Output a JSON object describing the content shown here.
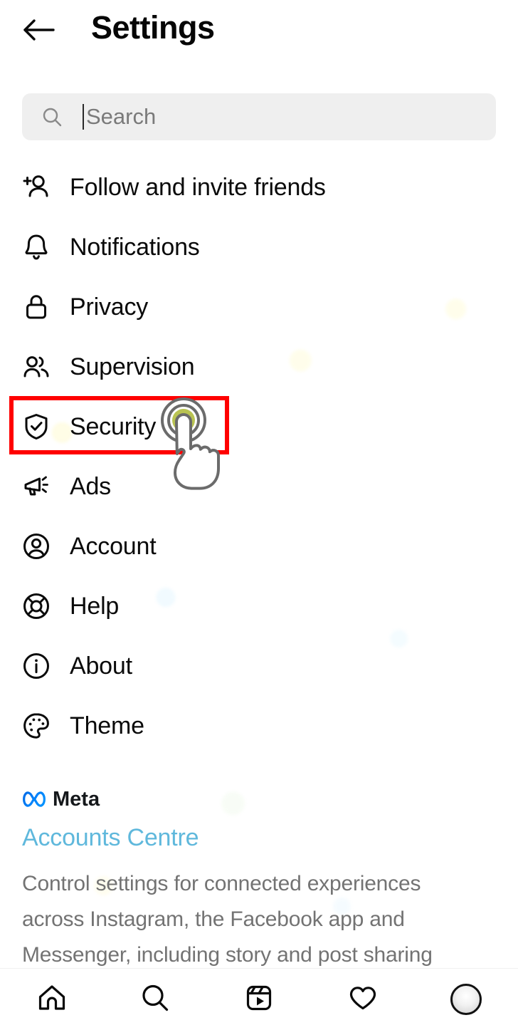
{
  "header": {
    "title": "Settings",
    "back_icon": "back-arrow-icon"
  },
  "search": {
    "placeholder": "Search",
    "value": "",
    "icon": "search-icon"
  },
  "menu": {
    "items": [
      {
        "label": "Follow and invite friends",
        "icon": "person-add-icon",
        "name": "follow-and-invite-friends"
      },
      {
        "label": "Notifications",
        "icon": "bell-icon",
        "name": "notifications"
      },
      {
        "label": "Privacy",
        "icon": "lock-icon",
        "name": "privacy"
      },
      {
        "label": "Supervision",
        "icon": "people-icon",
        "name": "supervision"
      },
      {
        "label": "Security",
        "icon": "shield-check-icon",
        "name": "security"
      },
      {
        "label": "Ads",
        "icon": "megaphone-icon",
        "name": "ads"
      },
      {
        "label": "Account",
        "icon": "person-circle-icon",
        "name": "account"
      },
      {
        "label": "Help",
        "icon": "lifebuoy-icon",
        "name": "help"
      },
      {
        "label": "About",
        "icon": "info-circle-icon",
        "name": "about"
      },
      {
        "label": "Theme",
        "icon": "palette-icon",
        "name": "theme"
      }
    ]
  },
  "highlight": {
    "target_label": "Security",
    "color": "#ff0000",
    "cursor": "tap-hand-cursor",
    "cursor_ring_color": "#a8bb45"
  },
  "meta": {
    "brand": "Meta",
    "logo_icon": "meta-infinity-icon",
    "accounts_centre_label": "Accounts Centre",
    "accounts_centre_color": "#5fb8dc",
    "description": "Control settings for connected experiences across Instagram, the Facebook app and Messenger, including story and post sharing"
  },
  "bottom_nav": {
    "items": [
      {
        "name": "nav-home",
        "icon": "home-icon"
      },
      {
        "name": "nav-search",
        "icon": "search-icon"
      },
      {
        "name": "nav-reels",
        "icon": "reels-icon"
      },
      {
        "name": "nav-activity",
        "icon": "heart-icon"
      },
      {
        "name": "nav-profile",
        "icon": "avatar-icon"
      }
    ]
  }
}
